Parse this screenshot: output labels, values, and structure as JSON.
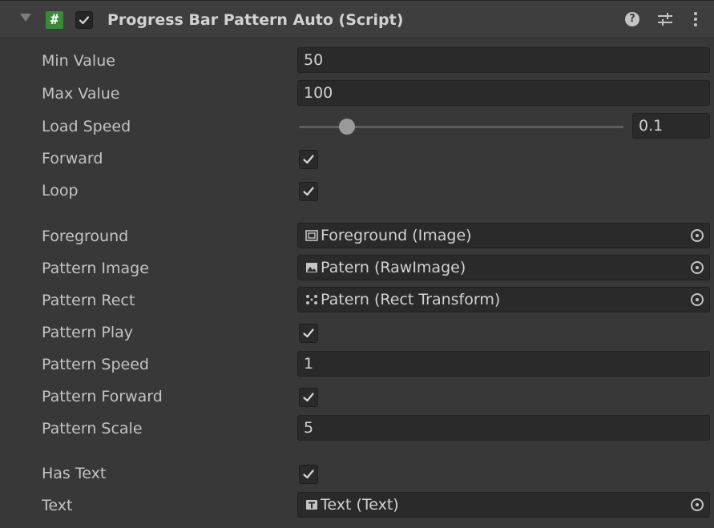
{
  "header": {
    "title": "Progress Bar Pattern Auto (Script)",
    "script_icon_glyph": "#",
    "enabled": true,
    "icons": [
      "foldout-arrow-icon",
      "script-icon",
      "help-icon",
      "presets-icon",
      "context-menu-icon"
    ]
  },
  "fields": {
    "min_value": {
      "label": "Min Value",
      "value": "50"
    },
    "max_value": {
      "label": "Max Value",
      "value": "100"
    },
    "load_speed": {
      "label": "Load Speed",
      "value": "0.1",
      "slider_fraction": 0.13
    },
    "forward": {
      "label": "Forward",
      "checked": true
    },
    "loop": {
      "label": "Loop",
      "checked": true
    },
    "foreground": {
      "label": "Foreground",
      "value": "Foreground (Image)",
      "icon": "image-component-icon"
    },
    "pattern_image": {
      "label": "Pattern Image",
      "value": "Patern (RawImage)",
      "icon": "rawimage-component-icon"
    },
    "pattern_rect": {
      "label": "Pattern Rect",
      "value": "Patern (Rect Transform)",
      "icon": "rect-transform-icon"
    },
    "pattern_play": {
      "label": "Pattern Play",
      "checked": true
    },
    "pattern_speed": {
      "label": "Pattern Speed",
      "value": "1"
    },
    "pattern_forward": {
      "label": "Pattern Forward",
      "checked": true
    },
    "pattern_scale": {
      "label": "Pattern Scale",
      "value": "5"
    },
    "has_text": {
      "label": "Has Text",
      "checked": true
    },
    "text": {
      "label": "Text",
      "value": "Text (Text)",
      "icon": "text-component-icon"
    }
  },
  "colors": {
    "background": "#383838",
    "header": "#3e3e3e",
    "field": "#2a2a2a",
    "text": "#c4c4c4",
    "script_icon": "#3a8a3a"
  }
}
